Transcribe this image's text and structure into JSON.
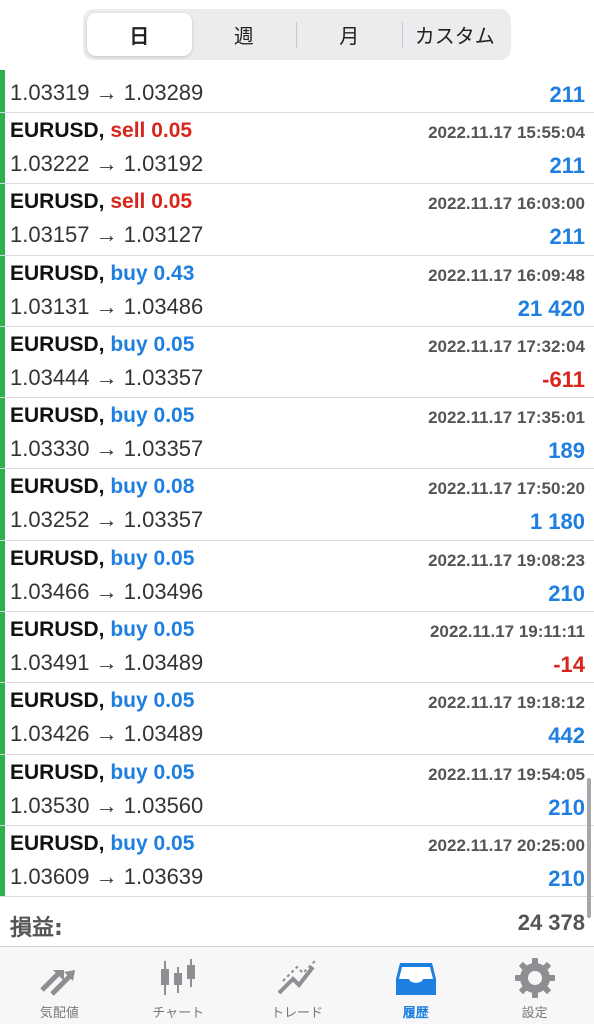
{
  "header": {
    "segments": [
      {
        "label": "日",
        "active": true
      },
      {
        "label": "週",
        "active": false
      },
      {
        "label": "月",
        "active": false
      },
      {
        "label": "カスタム",
        "active": false
      }
    ]
  },
  "deals": [
    {
      "symbol": "",
      "side": "",
      "volume": "",
      "time": "",
      "prices": "1.03319 → 1.03289",
      "profit": "211",
      "profit_sign": "pos"
    },
    {
      "symbol": "EURUSD,",
      "side": "sell",
      "volume": "0.05",
      "time": "2022.11.17 15:55:04",
      "prices": "1.03222 → 1.03192",
      "profit": "211",
      "profit_sign": "pos"
    },
    {
      "symbol": "EURUSD,",
      "side": "sell",
      "volume": "0.05",
      "time": "2022.11.17 16:03:00",
      "prices": "1.03157 → 1.03127",
      "profit": "211",
      "profit_sign": "pos"
    },
    {
      "symbol": "EURUSD,",
      "side": "buy",
      "volume": "0.43",
      "time": "2022.11.17 16:09:48",
      "prices": "1.03131 → 1.03486",
      "profit": "21 420",
      "profit_sign": "pos"
    },
    {
      "symbol": "EURUSD,",
      "side": "buy",
      "volume": "0.05",
      "time": "2022.11.17 17:32:04",
      "prices": "1.03444 → 1.03357",
      "profit": "-611",
      "profit_sign": "neg"
    },
    {
      "symbol": "EURUSD,",
      "side": "buy",
      "volume": "0.05",
      "time": "2022.11.17 17:35:01",
      "prices": "1.03330 → 1.03357",
      "profit": "189",
      "profit_sign": "pos"
    },
    {
      "symbol": "EURUSD,",
      "side": "buy",
      "volume": "0.08",
      "time": "2022.11.17 17:50:20",
      "prices": "1.03252 → 1.03357",
      "profit": "1 180",
      "profit_sign": "pos"
    },
    {
      "symbol": "EURUSD,",
      "side": "buy",
      "volume": "0.05",
      "time": "2022.11.17 19:08:23",
      "prices": "1.03466 → 1.03496",
      "profit": "210",
      "profit_sign": "pos"
    },
    {
      "symbol": "EURUSD,",
      "side": "buy",
      "volume": "0.05",
      "time": "2022.11.17 19:11:11",
      "prices": "1.03491 → 1.03489",
      "profit": "-14",
      "profit_sign": "neg"
    },
    {
      "symbol": "EURUSD,",
      "side": "buy",
      "volume": "0.05",
      "time": "2022.11.17 19:18:12",
      "prices": "1.03426 → 1.03489",
      "profit": "442",
      "profit_sign": "pos"
    },
    {
      "symbol": "EURUSD,",
      "side": "buy",
      "volume": "0.05",
      "time": "2022.11.17 19:54:05",
      "prices": "1.03530 → 1.03560",
      "profit": "210",
      "profit_sign": "pos"
    },
    {
      "symbol": "EURUSD,",
      "side": "buy",
      "volume": "0.05",
      "time": "2022.11.17 20:25:00",
      "prices": "1.03609 → 1.03639",
      "profit": "210",
      "profit_sign": "pos"
    }
  ],
  "summary": {
    "label": "損益:",
    "value": "24 378"
  },
  "tabbar": {
    "tabs": [
      {
        "label": "気配値",
        "icon": "quotes-arrows-icon",
        "active": false
      },
      {
        "label": "チャート",
        "icon": "candlestick-chart-icon",
        "active": false
      },
      {
        "label": "トレード",
        "icon": "trade-line-icon",
        "active": false
      },
      {
        "label": "履歴",
        "icon": "history-inbox-icon",
        "active": true
      },
      {
        "label": "設定",
        "icon": "gear-icon",
        "active": false
      }
    ]
  },
  "colors": {
    "buy": "#1e7fe0",
    "sell": "#d9261c",
    "profit_positive": "#1e7fe0",
    "profit_negative": "#d9261c",
    "row_marker": "#2bb24c",
    "tab_active": "#1e7fe0",
    "tab_inactive": "#8e8e93"
  }
}
